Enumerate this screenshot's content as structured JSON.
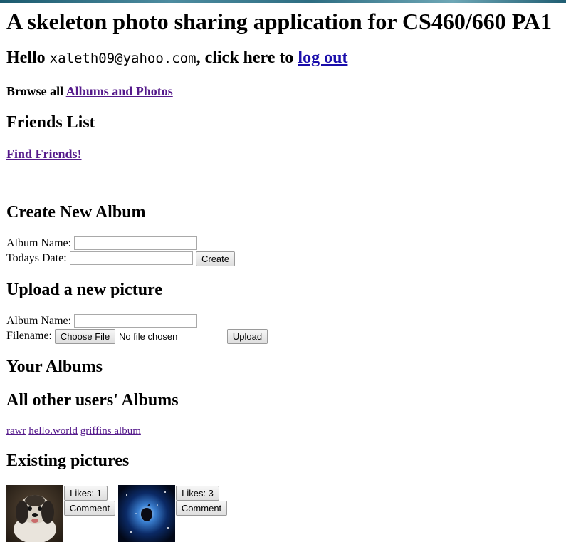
{
  "page": {
    "title": "A skeleton photo sharing application for CS460/660 PA1"
  },
  "greeting": {
    "hello": "Hello",
    "email": "xaleth09@yahoo.com",
    "middle": ", click here to",
    "logout_link": "log out"
  },
  "browse": {
    "prefix": "Browse all",
    "link": "Albums and Photos"
  },
  "friends": {
    "heading": "Friends List",
    "find_link": "Find Friends!"
  },
  "create_album": {
    "heading": "Create New Album",
    "album_name_label": "Album Name:",
    "album_name_value": "",
    "date_label": "Todays Date:",
    "date_value": "",
    "submit_label": "Create"
  },
  "upload": {
    "heading": "Upload a new picture",
    "album_name_label": "Album Name:",
    "album_name_value": "",
    "filename_label": "Filename:",
    "choose_file_label": "Choose File",
    "no_file_text": "No file chosen",
    "submit_label": "Upload"
  },
  "your_albums": {
    "heading": "Your Albums"
  },
  "other_albums": {
    "heading": "All other users' Albums",
    "links": [
      "rawr",
      "hello.world",
      "griffins album"
    ]
  },
  "existing_pictures": {
    "heading": "Existing pictures",
    "pictures": [
      {
        "likes_label": "Likes: 1",
        "comment_label": "Comment"
      },
      {
        "likes_label": "Likes: 3",
        "comment_label": "Comment"
      }
    ]
  }
}
